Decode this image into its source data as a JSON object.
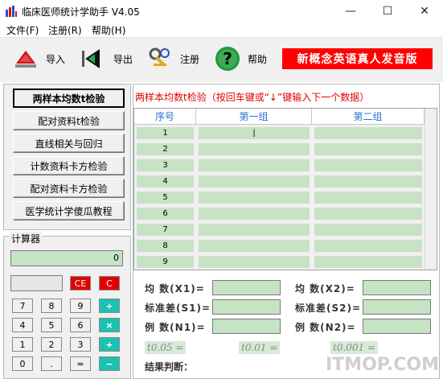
{
  "window": {
    "title": "临床医师统计学助手 V4.05",
    "minimize": "—",
    "maximize": "☐",
    "close": "✕"
  },
  "menu": [
    {
      "label": "文件(F)"
    },
    {
      "label": "注册(R)"
    },
    {
      "label": "帮助(H)"
    }
  ],
  "toolbar": {
    "import": "导入",
    "export": "导出",
    "register": "注册",
    "help": "帮助",
    "promo": "新概念英语真人发音版"
  },
  "left_buttons": [
    {
      "label": "两样本均数t检验"
    },
    {
      "label": "配对资料t检验"
    },
    {
      "label": "直线相关与回归"
    },
    {
      "label": "计数资料卡方检验"
    },
    {
      "label": "配对资料卡方检验"
    },
    {
      "label": "医学统计学傻瓜教程"
    }
  ],
  "calculator": {
    "title": "计算器",
    "display": "0",
    "keys": {
      "ce": "CE",
      "c": "C",
      "k7": "7",
      "k8": "8",
      "k9": "9",
      "div": "÷",
      "k4": "4",
      "k5": "5",
      "k6": "6",
      "mul": "×",
      "k1": "1",
      "k2": "2",
      "k3": "3",
      "add": "+",
      "k0": "0",
      "dot": ".",
      "eq": "=",
      "sub": "−"
    }
  },
  "main": {
    "header": "两样本均数t检验（按回车键或“↓”键输入下一个数据）",
    "columns": [
      "序号",
      "第一组",
      "第二组"
    ],
    "rows": [
      "1",
      "2",
      "3",
      "4",
      "5",
      "6",
      "7",
      "8",
      "9"
    ],
    "stats": {
      "mean1": "均  数(X1)=",
      "mean2": "均  数(X2)=",
      "sd1": "标准差(S1)=",
      "sd2": "标准差(S2)=",
      "n1": "例  数(N1)=",
      "n2": "例  数(N2)="
    },
    "t_values": {
      "t005": "t0.05 =",
      "t001": "t0.01 =",
      "t0001": "t0.001 ="
    },
    "result_label": "结果判断："
  },
  "watermark": "ITMOP.COM",
  "colors": {
    "accent_red": "#ff0000",
    "cell_green": "#c6e3c4",
    "header_blue": "#2a6fd6",
    "op_teal": "#19c2b1"
  }
}
